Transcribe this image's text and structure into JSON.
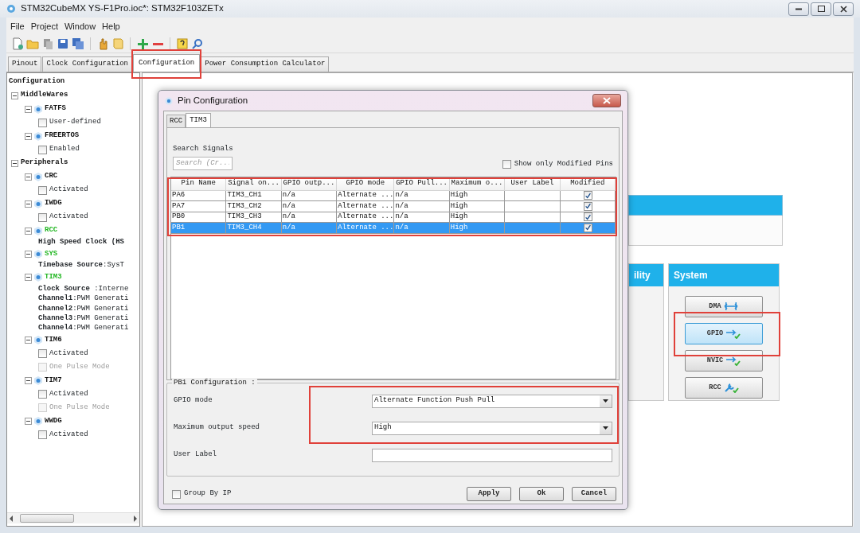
{
  "window": {
    "title": "STM32CubeMX YS-F1Pro.ioc*: STM32F103ZETx"
  },
  "menu": [
    "File",
    "Project",
    "Window",
    "Help"
  ],
  "tabs": [
    {
      "label": "Pinout",
      "selected": false,
      "highlighted": false
    },
    {
      "label": "Clock Configuration",
      "selected": false,
      "highlighted": false
    },
    {
      "label": "Configuration",
      "selected": true,
      "highlighted": true
    },
    {
      "label": "Power Consumption Calculator",
      "selected": false,
      "highlighted": false
    }
  ],
  "tree": {
    "label": "Configuration",
    "children": [
      {
        "kind": "group",
        "label": "MiddleWares",
        "children": [
          {
            "kind": "module",
            "label": "FATFS",
            "configured": false,
            "children": [
              {
                "kind": "checkbox",
                "label": "User-defined",
                "checked": false,
                "disabled": false
              }
            ]
          },
          {
            "kind": "module",
            "label": "FREERTOS",
            "configured": false,
            "children": [
              {
                "kind": "checkbox",
                "label": "Enabled",
                "checked": false,
                "disabled": false
              }
            ]
          }
        ]
      },
      {
        "kind": "group",
        "label": "Peripherals",
        "children": [
          {
            "kind": "module",
            "label": "CRC",
            "configured": false,
            "children": [
              {
                "kind": "checkbox",
                "label": "Activated",
                "checked": false,
                "disabled": false
              }
            ]
          },
          {
            "kind": "module",
            "label": "IWDG",
            "configured": false,
            "children": [
              {
                "kind": "checkbox",
                "label": "Activated",
                "checked": false,
                "disabled": false
              }
            ]
          },
          {
            "kind": "module",
            "label": "RCC",
            "configured": true,
            "children": [
              {
                "kind": "setting",
                "text": "**High Speed Clock (HS**"
              }
            ]
          },
          {
            "kind": "module",
            "label": "SYS",
            "configured": true,
            "children": [
              {
                "kind": "setting",
                "text": "**Timebase Source**:SysT"
              }
            ]
          },
          {
            "kind": "module",
            "label": "TIM3",
            "configured": true,
            "children": [
              {
                "kind": "setting",
                "text": "**Clock Source** :Interne"
              },
              {
                "kind": "setting",
                "text": "**Channel1**:PWM Generati"
              },
              {
                "kind": "setting",
                "text": "**Channel2**:PWM Generati"
              },
              {
                "kind": "setting",
                "text": "**Channel3**:PWM Generati"
              },
              {
                "kind": "setting",
                "text": "**Channel4**:PWM Generati"
              }
            ]
          },
          {
            "kind": "module",
            "label": "TIM6",
            "configured": false,
            "children": [
              {
                "kind": "checkbox",
                "label": "Activated",
                "checked": false,
                "disabled": false
              },
              {
                "kind": "checkbox",
                "label": "One Pulse Mode",
                "checked": false,
                "disabled": true
              }
            ]
          },
          {
            "kind": "module",
            "label": "TIM7",
            "configured": false,
            "children": [
              {
                "kind": "checkbox",
                "label": "Activated",
                "checked": false,
                "disabled": false
              },
              {
                "kind": "checkbox",
                "label": "One Pulse Mode",
                "checked": false,
                "disabled": true
              }
            ]
          },
          {
            "kind": "module",
            "label": "WWDG",
            "configured": false,
            "children": [
              {
                "kind": "checkbox",
                "label": "Activated",
                "checked": false,
                "disabled": false
              }
            ]
          }
        ]
      }
    ]
  },
  "categories": [
    {
      "title": "ility"
    },
    {
      "title": "System",
      "buttons": [
        {
          "label": "DMA",
          "highlighted": false
        },
        {
          "label": "GPIO",
          "highlighted": true
        },
        {
          "label": "NVIC",
          "highlighted": false
        },
        {
          "label": "RCC",
          "highlighted": false
        }
      ]
    }
  ],
  "dialog": {
    "title": "Pin Configuration",
    "tabs": [
      {
        "label": "RCC",
        "selected": false
      },
      {
        "label": "TIM3",
        "selected": true
      }
    ],
    "search": {
      "label": "Search Signals",
      "placeholder": "Search (Cr..."
    },
    "show_modified": {
      "label": "Show only Modified Pins",
      "checked": false
    },
    "table": {
      "highlighted": true,
      "columns": [
        "Pin Name",
        "Signal on...",
        "GPIO outp...",
        "GPIO mode",
        "GPIO Pull...",
        "Maximum o...",
        "User Label",
        "Modified"
      ],
      "rows": [
        {
          "cells": [
            "PA6",
            "TIM3_CH1",
            "n/a",
            "Alternate ...",
            "n/a",
            "High",
            ""
          ],
          "modified": true,
          "selected": false
        },
        {
          "cells": [
            "PA7",
            "TIM3_CH2",
            "n/a",
            "Alternate ...",
            "n/a",
            "High",
            ""
          ],
          "modified": true,
          "selected": false
        },
        {
          "cells": [
            "PB0",
            "TIM3_CH3",
            "n/a",
            "Alternate ...",
            "n/a",
            "High",
            ""
          ],
          "modified": true,
          "selected": false
        },
        {
          "cells": [
            "PB1",
            "TIM3_CH4",
            "n/a",
            "Alternate ...",
            "n/a",
            "High",
            ""
          ],
          "modified": true,
          "selected": true
        }
      ]
    },
    "config": {
      "title": "PB1 Configuration :",
      "fields": [
        {
          "kind": "select",
          "label": "GPIO mode",
          "value": "Alternate Function Push Pull",
          "highlighted": true
        },
        {
          "kind": "select",
          "label": "Maximum output speed",
          "value": "High",
          "highlighted": true
        },
        {
          "kind": "text",
          "label": "User Label"
        }
      ]
    },
    "group_by_ip": {
      "label": "Group By IP",
      "checked": false
    },
    "buttons": [
      "Apply",
      "Ok",
      "Cancel"
    ]
  }
}
